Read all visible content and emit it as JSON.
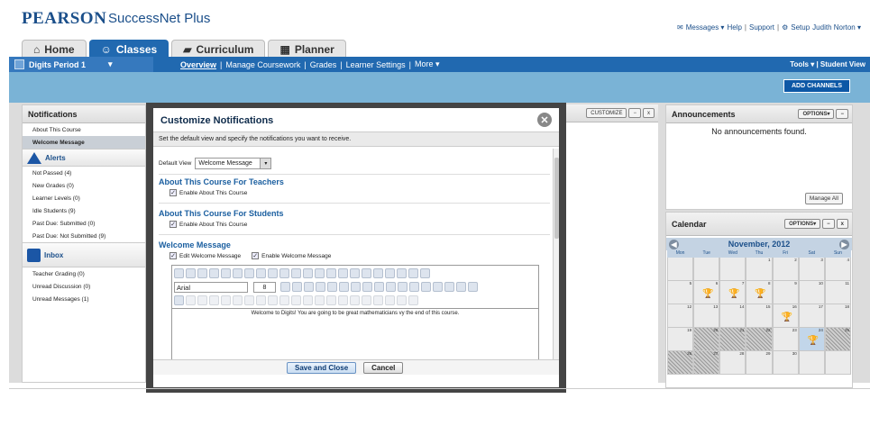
{
  "header": {
    "brand": "PEARSON",
    "product": "SuccessNet Plus",
    "links": {
      "messages": "Messages ▾",
      "help": "Help",
      "support": "Support",
      "setup": "Setup",
      "user": "Judith Norton ▾",
      "sep": "|"
    }
  },
  "tabs": [
    {
      "label": "Home",
      "icon": "home-icon"
    },
    {
      "label": "Classes",
      "icon": "users-icon",
      "active": true
    },
    {
      "label": "Curriculum",
      "icon": "folder-icon"
    },
    {
      "label": "Planner",
      "icon": "calendar-icon"
    }
  ],
  "subnav": {
    "period": "Digits Period 1",
    "period_arrow": "▾",
    "items": [
      "Overview",
      "Manage Coursework",
      "Grades",
      "Learner Settings",
      "More ▾"
    ],
    "sep": "|",
    "tools": "Tools ▾ | Student View"
  },
  "add_channels": "ADD CHANNELS",
  "notifications": {
    "title": "Notifications",
    "top_items": [
      "About This Course",
      "Welcome Message"
    ],
    "alerts_title": "Alerts",
    "alerts": [
      "Not Passed (4)",
      "New Grades (0)",
      "Learner Levels (0)",
      "Idle Students (9)",
      "Past Due: Submitted (0)",
      "Past Due: Not Submitted (9)"
    ],
    "inbox_title": "Inbox",
    "inbox": [
      "Teacher Grading (0)",
      "Unread Discussion (0)",
      "Unread Messages (1)"
    ]
  },
  "center_panel": {
    "customize": "CUSTOMIZE",
    "minimize": "−",
    "close": "x"
  },
  "modal": {
    "title": "Customize Notifications",
    "close": "✕",
    "instructions": "Set the default view and specify the notifications you want to receive.",
    "default_view_label": "Default View",
    "default_view_value": "Welcome Message",
    "dropdown_arrow": "▾",
    "section_teachers": "About This Course For Teachers",
    "enable_about": "Enable About This Course",
    "section_students": "About This Course For Students",
    "enable_about_students": "Enable About This Course",
    "section_welcome": "Welcome Message",
    "edit_welcome": "Edit Welcome Message",
    "enable_welcome": "Enable Welcome Message",
    "font": "Arial",
    "size": "8",
    "editor_text": "Welcome to Digits! You are going to be great mathematicians vy the end of this course.",
    "save": "Save and Close",
    "cancel": "Cancel",
    "checkmark": "✓"
  },
  "announcements": {
    "title": "Announcements",
    "options": "OPTIONS▾",
    "minimize": "−",
    "empty": "No announcements found.",
    "manage": "Manage All"
  },
  "calendar": {
    "title": "Calendar",
    "options": "OPTIONS▾",
    "minimize": "−",
    "close": "x",
    "month": "November, 2012",
    "prev": "◀",
    "next": "▶",
    "dow": [
      "Mon",
      "Tue",
      "Wed",
      "Thu",
      "Fri",
      "Sat",
      "Sun"
    ],
    "days": [
      "",
      "",
      "",
      "1",
      "2",
      "3",
      "4",
      "5",
      "6",
      "7",
      "8",
      "9",
      "10",
      "11",
      "12",
      "13",
      "14",
      "15",
      "16",
      "17",
      "18",
      "19",
      "20",
      "21",
      "22",
      "23",
      "24",
      "25",
      "26",
      "27",
      "28",
      "29",
      "30",
      "",
      ""
    ],
    "cup": "🏆"
  }
}
